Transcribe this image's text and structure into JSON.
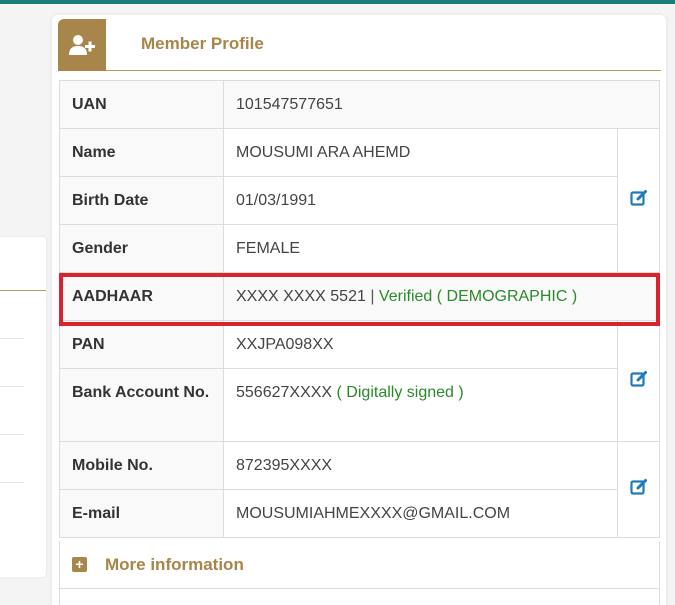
{
  "card": {
    "title": "Member Profile",
    "icon": "add-user-icon"
  },
  "profile": {
    "uan": {
      "label": "UAN",
      "value": "101547577651"
    },
    "name": {
      "label": "Name",
      "value": "MOUSUMI ARA AHEMD"
    },
    "birth_date": {
      "label": "Birth Date",
      "value": "01/03/1991"
    },
    "gender": {
      "label": "Gender",
      "value": "FEMALE"
    },
    "aadhaar": {
      "label": "AADHAAR",
      "value": "XXXX XXXX 5521",
      "separator": "|",
      "status": "Verified ( DEMOGRAPHIC )"
    },
    "pan": {
      "label": "PAN",
      "value": "XXJPA098XX"
    },
    "bank": {
      "label": "Bank Account No.",
      "value": "556627XXXX",
      "status": "( Digitally signed )"
    },
    "mobile": {
      "label": "Mobile No.",
      "value": "872395XXXX"
    },
    "email": {
      "label": "E-mail",
      "value": "MOUSUMIAHMEXXXX@GMAIL.COM"
    }
  },
  "more": {
    "label": "More information",
    "icon": "plus-square-icon"
  },
  "colors": {
    "accent": "#a8854a",
    "verified": "#2a8a2a",
    "highlight": "#d9232e",
    "edit_icon": "#1f7ab8",
    "top_bar": "#1a7d78"
  }
}
